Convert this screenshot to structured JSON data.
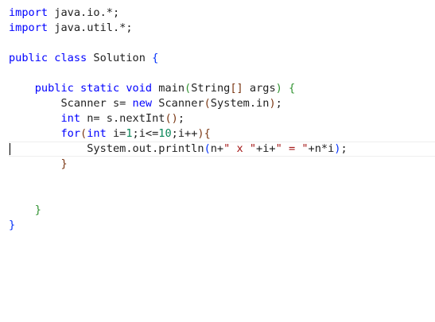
{
  "editor": {
    "line1": {
      "kw": "import",
      "rest": " java.io.*;"
    },
    "line2": {
      "kw": "import",
      "rest": " java.util.*;"
    },
    "line3": {
      "kw1": "public",
      "kw2": "class",
      "name": " Solution ",
      "brace": "{"
    },
    "line4": {
      "kw1": "public",
      "kw2": "static",
      "kw3": "void",
      "fn": "main",
      "open": "(",
      "type": "String",
      "arr": "[]",
      "arg": " args",
      "close": ")",
      "brace": "{"
    },
    "line5": {
      "type1": "Scanner",
      "var": " s= ",
      "kw": "new",
      "type2": " Scanner",
      "open": "(",
      "type3": "System",
      "field": ".in",
      "close": ")",
      "semi": ";"
    },
    "line6": {
      "kw": "int",
      "var": " n= s.",
      "fn": "nextInt",
      "parens": "()",
      "semi": ";"
    },
    "line7": {
      "kw1": "for",
      "open": "(",
      "kw2": "int",
      "init": " i=",
      "n1": "1",
      "cond": ";i<=",
      "n2": "10",
      "inc": ";i++",
      "close": ")",
      "brace": "{"
    },
    "line8": {
      "type": "System",
      "dot": ".",
      "field": "out",
      "dot2": ".",
      "fn": "println",
      "open": "(",
      "n1": "n+",
      "s1": "\" x \"",
      "mid": "+i+",
      "s2": "\" = \"",
      "end": "+n*i",
      "close": ")",
      "semi": ";"
    },
    "line9": {
      "brace": "}"
    },
    "line10": {
      "brace": "}"
    },
    "line11": {
      "brace": "}"
    }
  }
}
